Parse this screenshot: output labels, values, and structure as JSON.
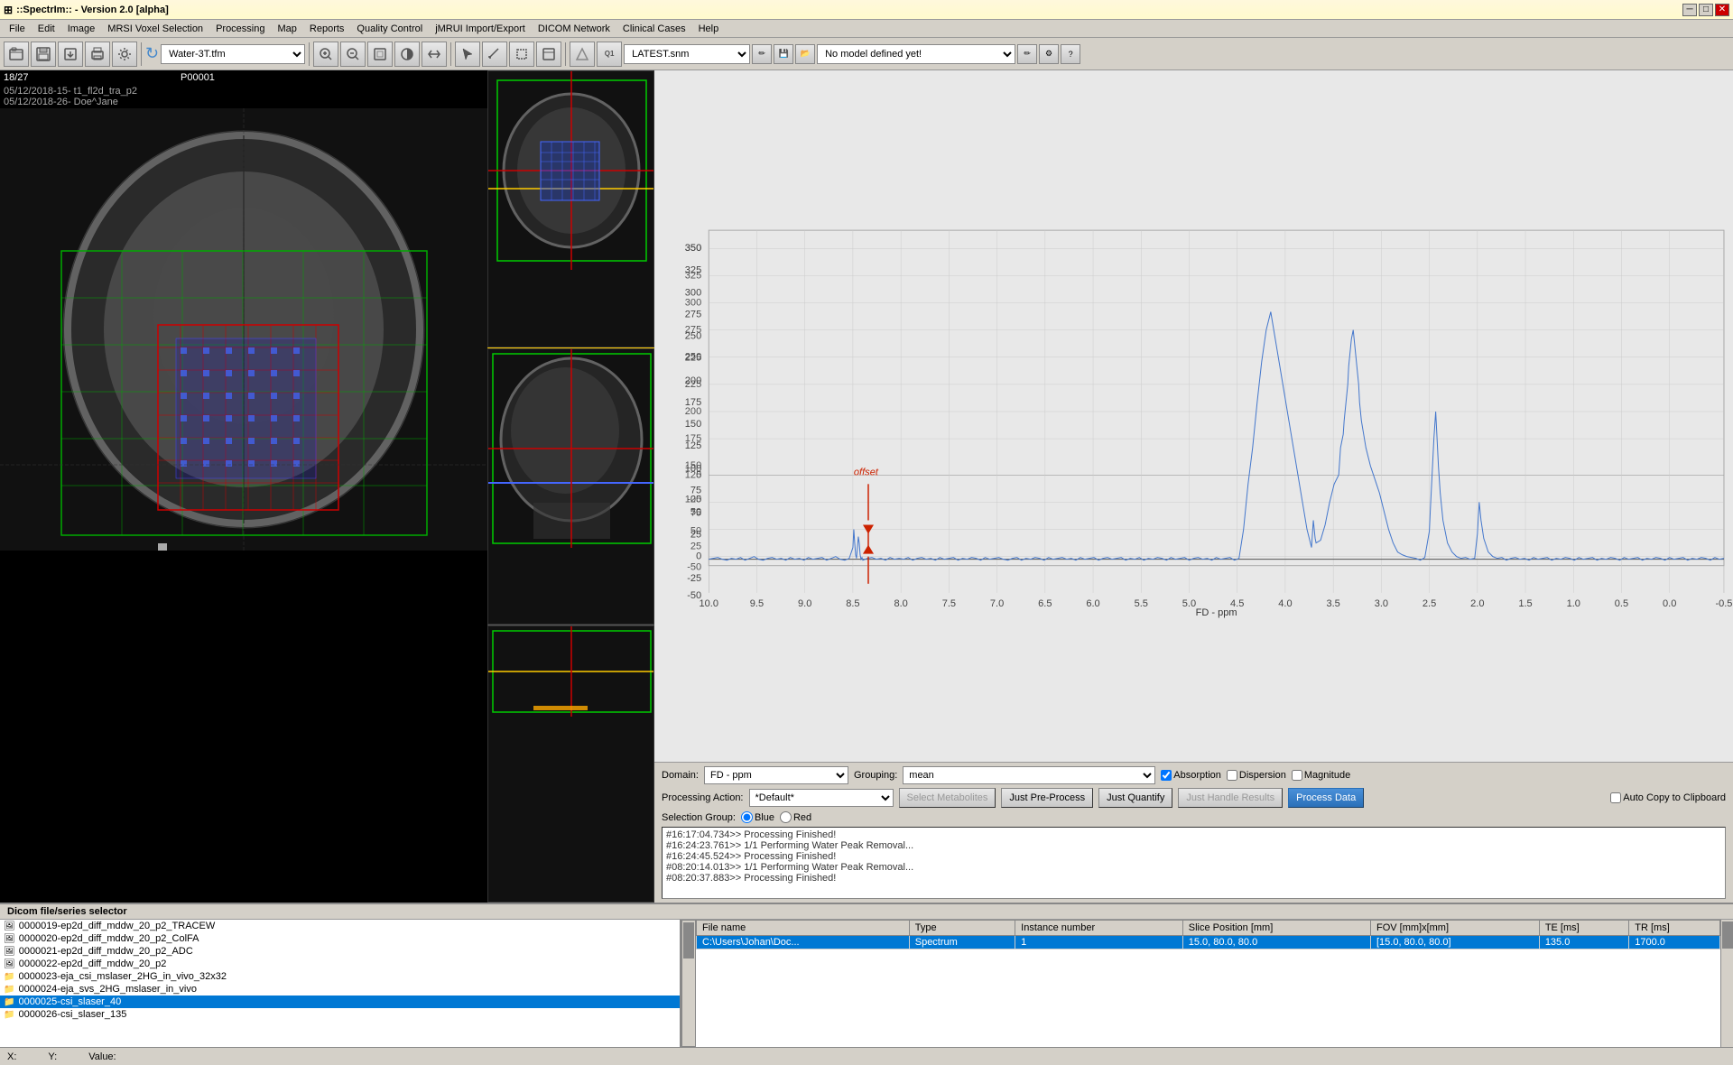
{
  "titlebar": {
    "title": "::SpectrIm:: - Version 2.0 [alpha]",
    "icon": "app-icon",
    "controls": [
      "minimize",
      "maximize",
      "close"
    ]
  },
  "menubar": {
    "items": [
      "File",
      "Edit",
      "Image",
      "MRSI Voxel Selection",
      "Processing",
      "Map",
      "Reports",
      "Quality Control",
      "jMRUI Import/Export",
      "DICOM Network",
      "Clinical Cases",
      "Help"
    ]
  },
  "toolbar": {
    "transform_dropdown": "Water-3T.tfm",
    "model_dropdown": "LATEST.snm",
    "fit_model_dropdown": "No model defined yet!"
  },
  "left_panel": {
    "counter": "18/27",
    "patient_id": "P00001",
    "date_series1": "05/12/2018-15- t1_fl2d_tra_p2",
    "date_series2": "05/12/2018-26- Doe^Jane"
  },
  "spectrum": {
    "x_axis_label": "FD - ppm",
    "x_ticks": [
      "10.0",
      "9.5",
      "9.0",
      "8.5",
      "8.0",
      "7.5",
      "7.0",
      "6.5",
      "6.0",
      "5.5",
      "5.0",
      "4.5",
      "4.0",
      "3.5",
      "3.0",
      "2.5",
      "2.0",
      "1.5",
      "1.0",
      "0.5",
      "0.0",
      "-0.5"
    ],
    "y_ticks": [
      "350",
      "325",
      "300",
      "275",
      "250",
      "225",
      "200",
      "175",
      "150",
      "125",
      "100",
      "75",
      "50",
      "25",
      "0",
      "-25",
      "-50"
    ],
    "offset_label": "offset"
  },
  "controls": {
    "domain_label": "Domain:",
    "domain_value": "FD - ppm",
    "grouping_label": "Grouping:",
    "grouping_value": "mean",
    "absorption_label": "Absorption",
    "dispersion_label": "Dispersion",
    "magnitude_label": "Magnitude",
    "absorption_checked": true,
    "dispersion_checked": false,
    "magnitude_checked": false,
    "processing_action_label": "Processing Action:",
    "processing_action_value": "*Default*",
    "btn_select_metabolites": "Select Metabolites",
    "btn_just_preprocess": "Just Pre-Process",
    "btn_just_quantify": "Just Quantify",
    "btn_just_handle": "Just Handle Results",
    "btn_process_data": "Process Data",
    "selection_group_label": "Selection Group:",
    "selection_blue": "Blue",
    "selection_red": "Red",
    "auto_copy_label": "Auto Copy to Clipboard"
  },
  "log": {
    "entries": [
      "#16:17:04.734>> Processing Finished!",
      "#16:24:23.761>> 1/1 Performing Water Peak Removal...",
      "#16:24:45.524>> Processing Finished!",
      "#08:20:14.013>> 1/1 Performing Water Peak Removal...",
      "#08:20:37.883>> Processing Finished!"
    ]
  },
  "bottom_panel": {
    "title": "Dicom file/series selector",
    "file_list": [
      {
        "id": "0000019-ep2d_diff_mddw_20_p2_TRACEW",
        "selected": false,
        "icon": "img"
      },
      {
        "id": "0000020-ep2d_diff_mddw_20_p2_ColFA",
        "selected": false,
        "icon": "img"
      },
      {
        "id": "0000021-ep2d_diff_mddw_20_p2_ADC",
        "selected": false,
        "icon": "img"
      },
      {
        "id": "0000022-ep2d_diff_mddw_20_p2",
        "selected": false,
        "icon": "img"
      },
      {
        "id": "0000023-eja_csi_mslaser_2HG_in_vivo_32x32",
        "selected": false,
        "icon": "folder"
      },
      {
        "id": "0000024-eja_svs_2HG_mslaser_in_vivo",
        "selected": false,
        "icon": "folder"
      },
      {
        "id": "0000025-csi_slaser_40",
        "selected": true,
        "icon": "folder"
      },
      {
        "id": "0000026-csi_slaser_135",
        "selected": false,
        "icon": "folder"
      }
    ],
    "table_headers": [
      "File name",
      "Type",
      "Instance number",
      "Slice Position [mm]",
      "FOV [mm]x[mm]",
      "TE [ms]",
      "TR [ms]"
    ],
    "table_rows": [
      {
        "filename": "C:\\Users\\Johan\\Doc...",
        "type": "Spectrum",
        "instance": "1",
        "slice_pos": "15.0, 80.0, 80.0",
        "fov": "[15.0, 80.0, 80.0]",
        "te": "135.0",
        "tr": "1700.0",
        "selected": true
      }
    ]
  },
  "statusbar": {
    "x_label": "X:",
    "y_label": "Y:",
    "value_label": "Value:"
  }
}
